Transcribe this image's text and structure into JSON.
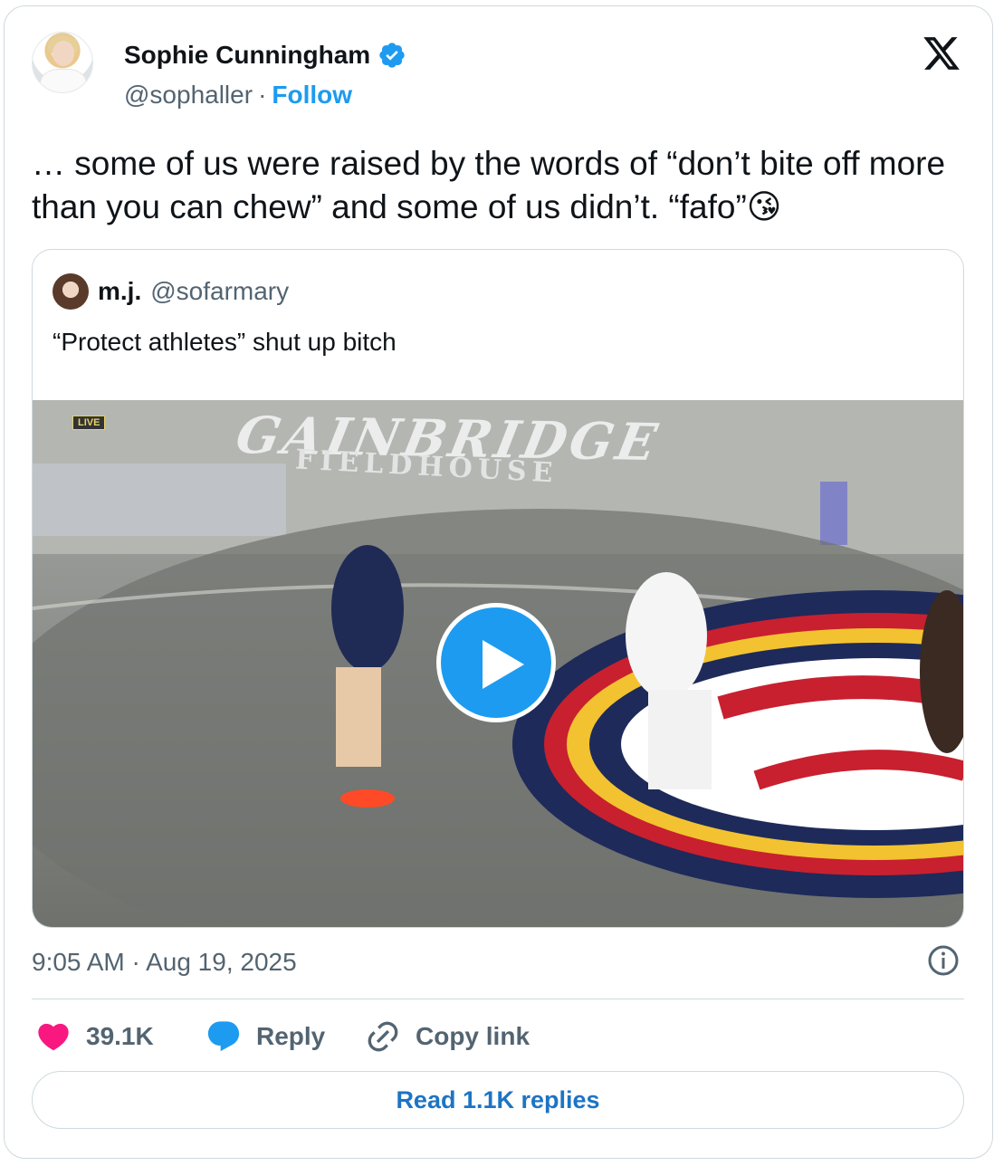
{
  "author": {
    "name": "Sophie Cunningham",
    "handle": "@sophaller",
    "separator": "·",
    "follow_label": "Follow"
  },
  "tweet": {
    "text": "… some of us were raised by the words of “don’t bite off more than you can chew” and some of us didn’t. “fafo”😘",
    "timestamp": "9:05 AM · Aug 19, 2025"
  },
  "quoted_tweet": {
    "name": "m.j.",
    "handle": "@sofarmary",
    "text": "“Protect athletes” shut up bitch",
    "media": {
      "live_badge": "LIVE",
      "arena_title": "GAINBRIDGE",
      "arena_subtitle": "FIELDHOUSE"
    }
  },
  "actions": {
    "like_count": "39.1K",
    "reply_label": "Reply",
    "copy_link_label": "Copy link",
    "read_replies_label": "Read 1.1K replies"
  },
  "colors": {
    "accent": "#1d9bf0",
    "like": "#f91880",
    "muted": "#536471",
    "border": "#cfd9de"
  },
  "icons": [
    "verified-badge-icon",
    "x-logo-icon",
    "play-icon",
    "info-icon",
    "heart-icon",
    "reply-bubble-icon",
    "link-icon"
  ]
}
